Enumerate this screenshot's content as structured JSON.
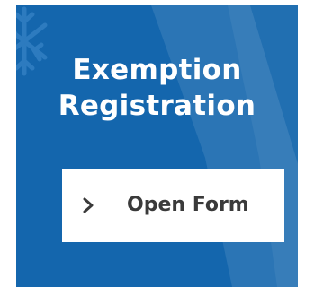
{
  "card": {
    "title_line1": "Exemption",
    "title_line2": "Registration",
    "background_color": "#1466ad",
    "decor_icon": "snowflake-icon"
  },
  "button": {
    "label": "Open Form",
    "icon": "chevron-right-icon"
  }
}
